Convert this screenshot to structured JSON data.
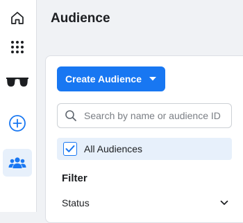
{
  "header": {
    "title": "Audience"
  },
  "nav_rail": {
    "items": [
      {
        "icon": "home-icon"
      },
      {
        "icon": "apps-grid-icon"
      },
      {
        "icon": "sunglasses-icon"
      },
      {
        "icon": "plus-circle-icon"
      },
      {
        "icon": "audience-people-icon",
        "active": true
      }
    ]
  },
  "toolbar": {
    "create_label": "Create Audience"
  },
  "search": {
    "placeholder": "Search by name or audience ID",
    "value": ""
  },
  "audience_list": {
    "all_label": "All Audiences",
    "all_checked": true
  },
  "filter": {
    "heading": "Filter",
    "status_label": "Status"
  },
  "colors": {
    "accent": "#1877f2",
    "background": "#f0f2f5",
    "selected_row": "#e7f0fb",
    "text": "#1c1e21"
  }
}
